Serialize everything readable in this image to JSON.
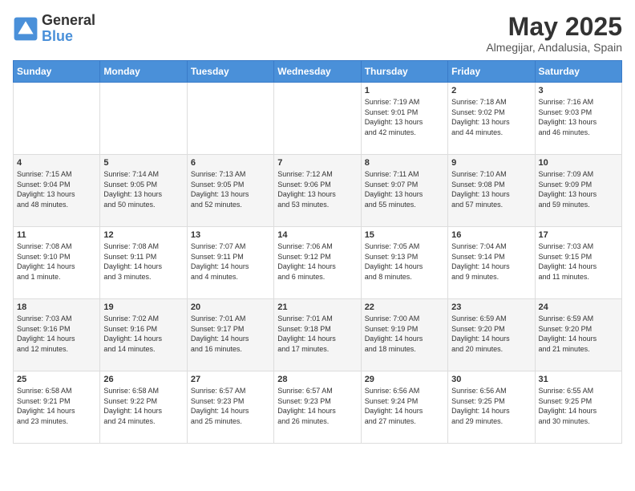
{
  "header": {
    "logo_line1": "General",
    "logo_line2": "Blue",
    "month": "May 2025",
    "location": "Almegijar, Andalusia, Spain"
  },
  "days_of_week": [
    "Sunday",
    "Monday",
    "Tuesday",
    "Wednesday",
    "Thursday",
    "Friday",
    "Saturday"
  ],
  "weeks": [
    [
      {
        "day": "",
        "info": ""
      },
      {
        "day": "",
        "info": ""
      },
      {
        "day": "",
        "info": ""
      },
      {
        "day": "",
        "info": ""
      },
      {
        "day": "1",
        "info": "Sunrise: 7:19 AM\nSunset: 9:01 PM\nDaylight: 13 hours\nand 42 minutes."
      },
      {
        "day": "2",
        "info": "Sunrise: 7:18 AM\nSunset: 9:02 PM\nDaylight: 13 hours\nand 44 minutes."
      },
      {
        "day": "3",
        "info": "Sunrise: 7:16 AM\nSunset: 9:03 PM\nDaylight: 13 hours\nand 46 minutes."
      }
    ],
    [
      {
        "day": "4",
        "info": "Sunrise: 7:15 AM\nSunset: 9:04 PM\nDaylight: 13 hours\nand 48 minutes."
      },
      {
        "day": "5",
        "info": "Sunrise: 7:14 AM\nSunset: 9:05 PM\nDaylight: 13 hours\nand 50 minutes."
      },
      {
        "day": "6",
        "info": "Sunrise: 7:13 AM\nSunset: 9:05 PM\nDaylight: 13 hours\nand 52 minutes."
      },
      {
        "day": "7",
        "info": "Sunrise: 7:12 AM\nSunset: 9:06 PM\nDaylight: 13 hours\nand 53 minutes."
      },
      {
        "day": "8",
        "info": "Sunrise: 7:11 AM\nSunset: 9:07 PM\nDaylight: 13 hours\nand 55 minutes."
      },
      {
        "day": "9",
        "info": "Sunrise: 7:10 AM\nSunset: 9:08 PM\nDaylight: 13 hours\nand 57 minutes."
      },
      {
        "day": "10",
        "info": "Sunrise: 7:09 AM\nSunset: 9:09 PM\nDaylight: 13 hours\nand 59 minutes."
      }
    ],
    [
      {
        "day": "11",
        "info": "Sunrise: 7:08 AM\nSunset: 9:10 PM\nDaylight: 14 hours\nand 1 minute."
      },
      {
        "day": "12",
        "info": "Sunrise: 7:08 AM\nSunset: 9:11 PM\nDaylight: 14 hours\nand 3 minutes."
      },
      {
        "day": "13",
        "info": "Sunrise: 7:07 AM\nSunset: 9:11 PM\nDaylight: 14 hours\nand 4 minutes."
      },
      {
        "day": "14",
        "info": "Sunrise: 7:06 AM\nSunset: 9:12 PM\nDaylight: 14 hours\nand 6 minutes."
      },
      {
        "day": "15",
        "info": "Sunrise: 7:05 AM\nSunset: 9:13 PM\nDaylight: 14 hours\nand 8 minutes."
      },
      {
        "day": "16",
        "info": "Sunrise: 7:04 AM\nSunset: 9:14 PM\nDaylight: 14 hours\nand 9 minutes."
      },
      {
        "day": "17",
        "info": "Sunrise: 7:03 AM\nSunset: 9:15 PM\nDaylight: 14 hours\nand 11 minutes."
      }
    ],
    [
      {
        "day": "18",
        "info": "Sunrise: 7:03 AM\nSunset: 9:16 PM\nDaylight: 14 hours\nand 12 minutes."
      },
      {
        "day": "19",
        "info": "Sunrise: 7:02 AM\nSunset: 9:16 PM\nDaylight: 14 hours\nand 14 minutes."
      },
      {
        "day": "20",
        "info": "Sunrise: 7:01 AM\nSunset: 9:17 PM\nDaylight: 14 hours\nand 16 minutes."
      },
      {
        "day": "21",
        "info": "Sunrise: 7:01 AM\nSunset: 9:18 PM\nDaylight: 14 hours\nand 17 minutes."
      },
      {
        "day": "22",
        "info": "Sunrise: 7:00 AM\nSunset: 9:19 PM\nDaylight: 14 hours\nand 18 minutes."
      },
      {
        "day": "23",
        "info": "Sunrise: 6:59 AM\nSunset: 9:20 PM\nDaylight: 14 hours\nand 20 minutes."
      },
      {
        "day": "24",
        "info": "Sunrise: 6:59 AM\nSunset: 9:20 PM\nDaylight: 14 hours\nand 21 minutes."
      }
    ],
    [
      {
        "day": "25",
        "info": "Sunrise: 6:58 AM\nSunset: 9:21 PM\nDaylight: 14 hours\nand 23 minutes."
      },
      {
        "day": "26",
        "info": "Sunrise: 6:58 AM\nSunset: 9:22 PM\nDaylight: 14 hours\nand 24 minutes."
      },
      {
        "day": "27",
        "info": "Sunrise: 6:57 AM\nSunset: 9:23 PM\nDaylight: 14 hours\nand 25 minutes."
      },
      {
        "day": "28",
        "info": "Sunrise: 6:57 AM\nSunset: 9:23 PM\nDaylight: 14 hours\nand 26 minutes."
      },
      {
        "day": "29",
        "info": "Sunrise: 6:56 AM\nSunset: 9:24 PM\nDaylight: 14 hours\nand 27 minutes."
      },
      {
        "day": "30",
        "info": "Sunrise: 6:56 AM\nSunset: 9:25 PM\nDaylight: 14 hours\nand 29 minutes."
      },
      {
        "day": "31",
        "info": "Sunrise: 6:55 AM\nSunset: 9:25 PM\nDaylight: 14 hours\nand 30 minutes."
      }
    ]
  ]
}
